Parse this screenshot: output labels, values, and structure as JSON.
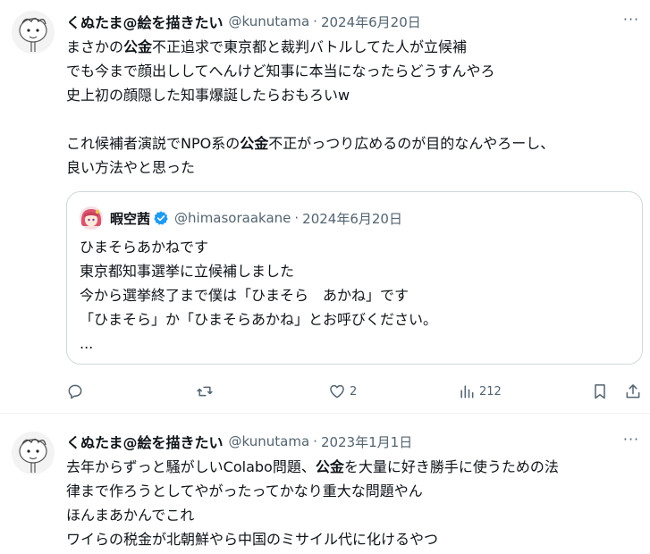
{
  "tweets": [
    {
      "author_name": "くぬたま@絵を描きたい",
      "handle": "@kunutama",
      "separator": "·",
      "date": "2024年6月20日",
      "lines": [
        [
          "まさかの",
          "公金",
          "不正追求で東京都と裁判バトルしてた人が立候補"
        ],
        [
          "でも今まで顔出ししてへんけど知事に本当になったらどうすんやろ"
        ],
        [
          "史上初の顔隠した知事爆誕したらおもろいw"
        ],
        [],
        [
          "これ候補者演説でNPO系の",
          "公金",
          "不正がっつり広めるのが目的なんやろーし、"
        ],
        [
          "良い方法やと思った"
        ]
      ],
      "quote": {
        "author_name": "暇空茜",
        "handle": "@himasoraakane",
        "separator": "·",
        "date": "2024年6月20日",
        "lines": [
          "ひまそらあかねです",
          "東京都知事選挙に立候補しました",
          "今から選挙終了まで僕は「ひまそら　あかね」です",
          "「ひまそら」か「ひまそらあかね」とお呼びください。",
          "..."
        ]
      },
      "actions": {
        "reply_count": "",
        "retweet_count": "",
        "like_count": "2",
        "views_count": "212"
      }
    },
    {
      "author_name": "くぬたま@絵を描きたい",
      "handle": "@kunutama",
      "separator": "·",
      "date": "2023年1月1日",
      "lines": [
        [
          "去年からずっと騒がしいColabo問題、",
          "公金",
          "を大量に好き勝手に使うための法"
        ],
        [
          "律まで作ろうとしてやがったってかなり重大な問題やん"
        ],
        [
          "ほんまあかんでこれ"
        ],
        [
          "ワイらの税金が北朝鮮やら中国のミサイル代に化けるやつ"
        ]
      ]
    }
  ],
  "more_label": "···",
  "icons": {
    "more": "more-horizontal-icon",
    "reply": "reply-icon",
    "retweet": "retweet-icon",
    "like": "like-icon",
    "views": "views-icon",
    "bookmark": "bookmark-icon",
    "share": "share-icon",
    "verified": "verified-badge-icon"
  },
  "colors": {
    "text": "#0f1419",
    "secondary": "#536471",
    "verified": "#1d9bf0",
    "border": "#cfd9de"
  }
}
